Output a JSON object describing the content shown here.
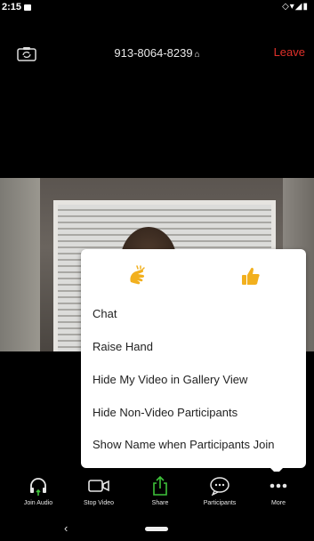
{
  "status_bar": {
    "time": "2:15",
    "icons": "◇▾◢▮"
  },
  "top_bar": {
    "meeting_id": "913-8064-8239",
    "lock_glyph": "⌂",
    "leave_label": "Leave",
    "leave_color": "#e0302a"
  },
  "reactions_menu": {
    "reactions": [
      "clap-icon",
      "thumbs-up-icon"
    ],
    "items": [
      "Chat",
      "Raise Hand",
      "Hide My Video in Gallery View",
      "Hide Non-Video Participants",
      "Show Name when Participants Join"
    ]
  },
  "toolbar": {
    "buttons": [
      {
        "label": "Join Audio",
        "icon": "headphones-icon"
      },
      {
        "label": "Stop Video",
        "icon": "video-camera-icon"
      },
      {
        "label": "Share",
        "icon": "share-icon"
      },
      {
        "label": "Participants",
        "icon": "participants-icon"
      },
      {
        "label": "More",
        "icon": "more-icon"
      }
    ],
    "accent_green": "#3ec23a"
  },
  "nav_bar": {
    "back_glyph": "‹"
  }
}
